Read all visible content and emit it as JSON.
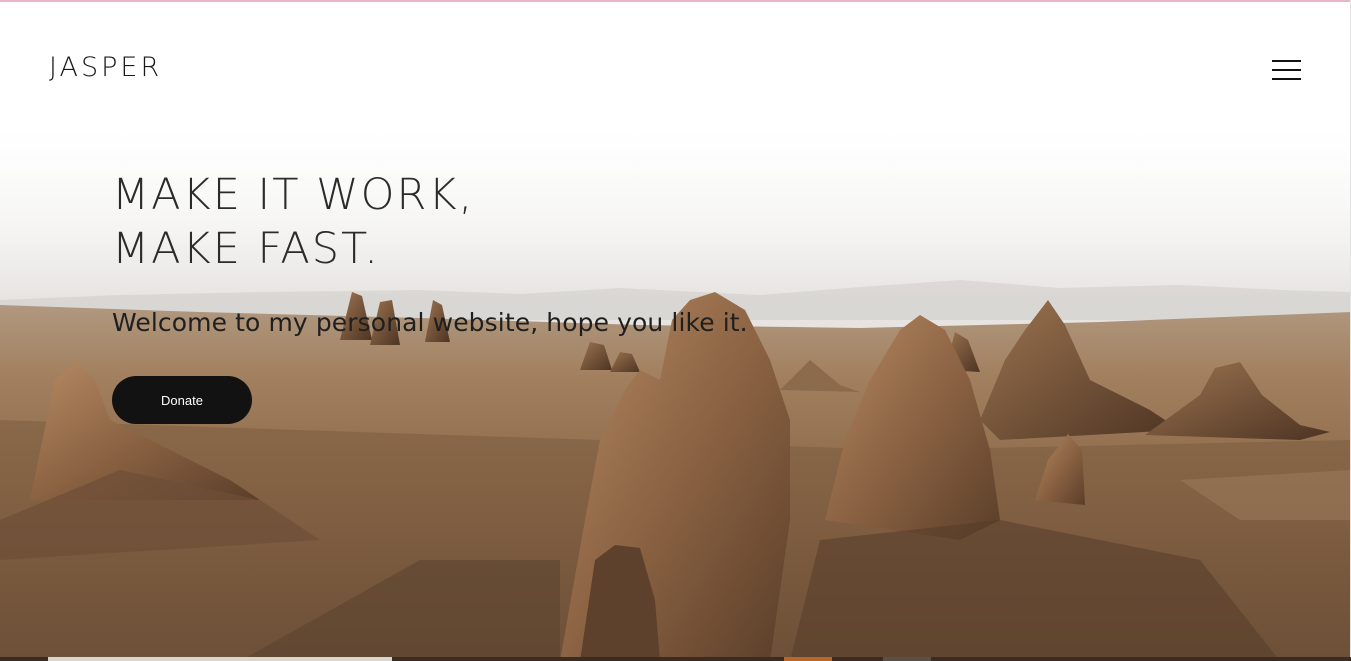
{
  "site": {
    "logo_text": "JASPER",
    "menu_icon": "hamburger-menu-icon"
  },
  "hero": {
    "headline_line1": "MAKE IT WORK,",
    "headline_line2": "MAKE FAST.",
    "subtext": "Welcome to my personal website, hope you like it.",
    "donate_label": "Donate",
    "background_image": "desert rock pinnacles landscape"
  },
  "colors": {
    "accent_top_rule": "#e9b7c4",
    "button_bg": "#121212",
    "button_text": "#ffffff",
    "text_dark": "#2b2b2b"
  }
}
